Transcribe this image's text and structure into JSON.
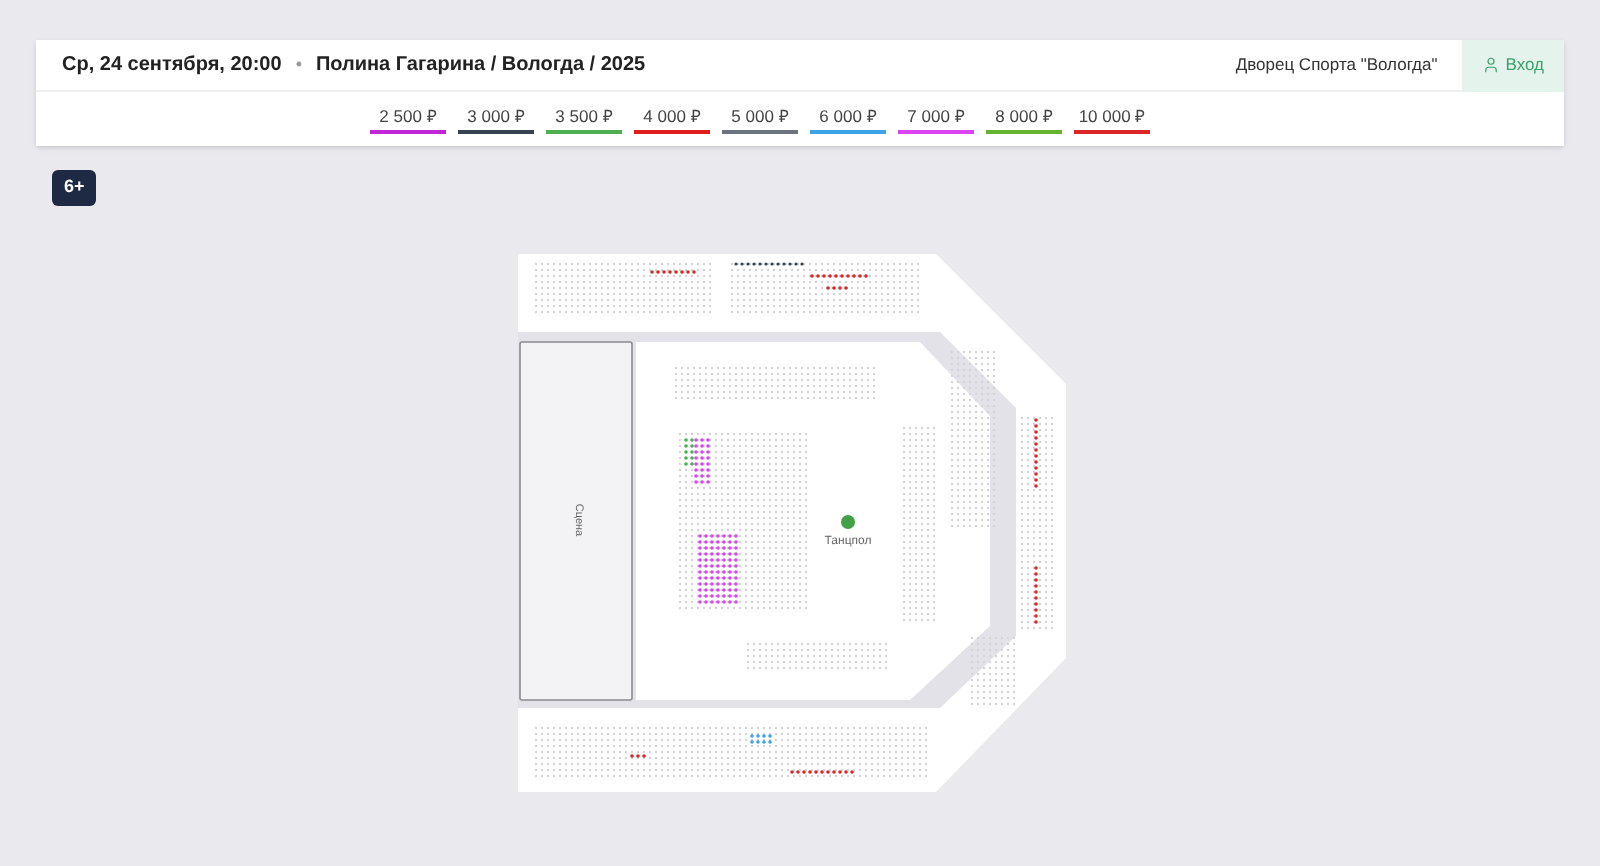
{
  "header": {
    "date": "Ср, 24 сентября, 20:00",
    "separator": "•",
    "event": "Полина Гагарина / Вологда / 2025",
    "venue": "Дворец Спорта \"Вологда\"",
    "login": "Вход"
  },
  "prices": [
    {
      "label": "2 500 ₽",
      "color": "#c026d3"
    },
    {
      "label": "3 000 ₽",
      "color": "#374151"
    },
    {
      "label": "3 500 ₽",
      "color": "#4caf50"
    },
    {
      "label": "4 000 ₽",
      "color": "#e11d1d"
    },
    {
      "label": "5 000 ₽",
      "color": "#6b7280"
    },
    {
      "label": "6 000 ₽",
      "color": "#3ba3e8"
    },
    {
      "label": "7 000 ₽",
      "color": "#d946ef"
    },
    {
      "label": "8 000 ₽",
      "color": "#65b32e"
    },
    {
      "label": "10 000 ₽",
      "color": "#dc2626"
    }
  ],
  "age_badge": "6+",
  "map": {
    "stage": "Сцена",
    "dance_floor": "Танцпол"
  }
}
